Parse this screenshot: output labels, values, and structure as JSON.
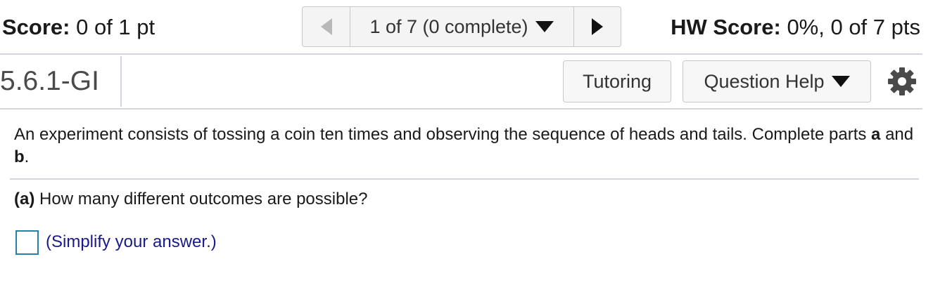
{
  "header": {
    "score_label": "Score:",
    "score_value": "0 of 1 pt",
    "nav": {
      "position_text": "1 of 7 (0 complete)"
    },
    "hw_score_label": "HW Score:",
    "hw_score_value": "0%, 0 of 7 pts"
  },
  "question_bar": {
    "question_id": "5.6.1-GI",
    "tutoring_label": "Tutoring",
    "help_label": "Question Help"
  },
  "problem": {
    "intro": "An experiment consists of tossing a coin ten times and observing the sequence of heads and tails. Complete parts",
    "part_a_letter": "a",
    "and": "and",
    "part_b_letter": "b",
    "period": "."
  },
  "part_a": {
    "label": "(a)",
    "question": "How many different outcomes are possible?",
    "answer_value": "",
    "hint": "(Simplify your answer.)"
  },
  "icons": {
    "prev": "triangle-left-icon",
    "next": "triangle-right-icon",
    "dropdown": "caret-down-icon",
    "settings": "gear-icon"
  },
  "colors": {
    "answer_border": "#2a7fa6",
    "hint_text": "#1a1a8c"
  }
}
